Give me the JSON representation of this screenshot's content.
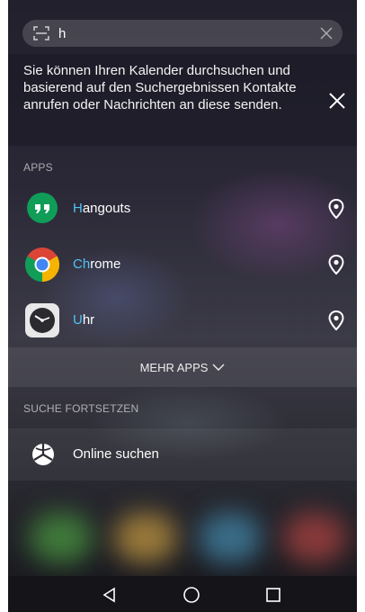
{
  "search": {
    "query": "h"
  },
  "info": {
    "message": "Sie können Ihren Kalender durchsuchen und basierend auf den Suchergebnissen Kontakte anrufen oder Nachrichten an diese senden."
  },
  "apps": {
    "header": "APPS",
    "items": [
      {
        "match": "H",
        "rest": "angouts",
        "icon": "hangouts-icon"
      },
      {
        "match": "Ch",
        "rest": "rome",
        "icon": "chrome-icon"
      },
      {
        "match": "U",
        "rest": "hr",
        "icon": "clock-icon"
      }
    ],
    "more_label": "MEHR APPS"
  },
  "continue_search": {
    "header": "SUCHE FORTSETZEN",
    "online_label": "Online suchen"
  },
  "colors": {
    "highlight": "#4fc3f7",
    "hangouts_green": "#0f9d58",
    "chrome_red": "#db4437",
    "chrome_yellow": "#f4b400",
    "chrome_green": "#0f9d58",
    "chrome_blue": "#4285f4"
  }
}
